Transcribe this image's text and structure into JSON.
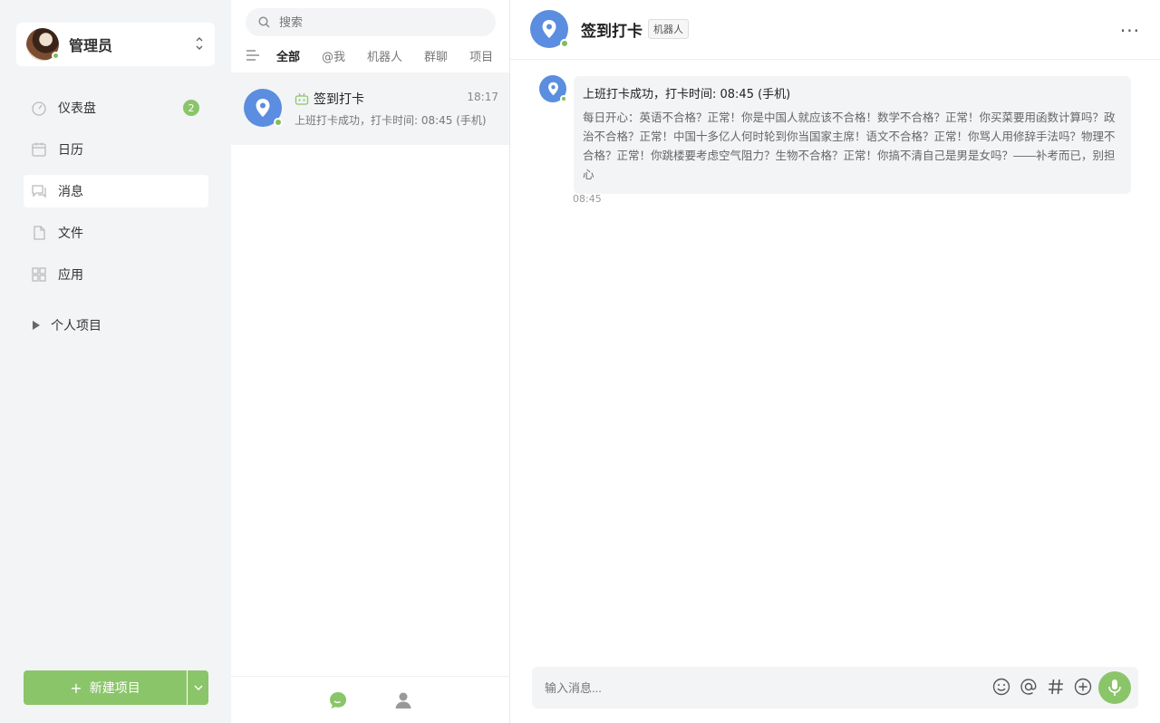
{
  "sidebar": {
    "user": {
      "name": "管理员"
    },
    "nav": [
      {
        "label": "仪表盘",
        "icon": "dashboard-icon",
        "badge": "2"
      },
      {
        "label": "日历",
        "icon": "calendar-icon"
      },
      {
        "label": "消息",
        "icon": "message-icon",
        "active": true
      },
      {
        "label": "文件",
        "icon": "file-icon"
      },
      {
        "label": "应用",
        "icon": "apps-icon"
      }
    ],
    "section_label": "个人项目",
    "new_project_label": "新建项目"
  },
  "chat_list": {
    "search_placeholder": "搜索",
    "filters": [
      "全部",
      "@我",
      "机器人",
      "群聊",
      "项目"
    ],
    "items": [
      {
        "title": "签到打卡",
        "time": "18:17",
        "preview": "上班打卡成功，打卡时间: 08:45 (手机)"
      }
    ]
  },
  "conversation": {
    "title": "签到打卡",
    "tag": "机器人",
    "message": {
      "line1": "上班打卡成功，打卡时间: 08:45 (手机)",
      "body": "每日开心：英语不合格？正常！你是中国人就应该不合格！数学不合格？正常！你买菜要用函数计算吗？政治不合格？正常！中国十多亿人何时轮到你当国家主席！语文不合格？正常！你骂人用修辞手法吗？物理不合格？正常！你跳楼要考虑空气阻力？生物不合格？正常！你搞不清自己是男是女吗？——补考而已，别担心",
      "time": "08:45"
    },
    "input_placeholder": "输入消息..."
  },
  "colors": {
    "accent": "#8bc56a",
    "bot_avatar": "#5b8de0",
    "online": "#7fbd5f"
  }
}
